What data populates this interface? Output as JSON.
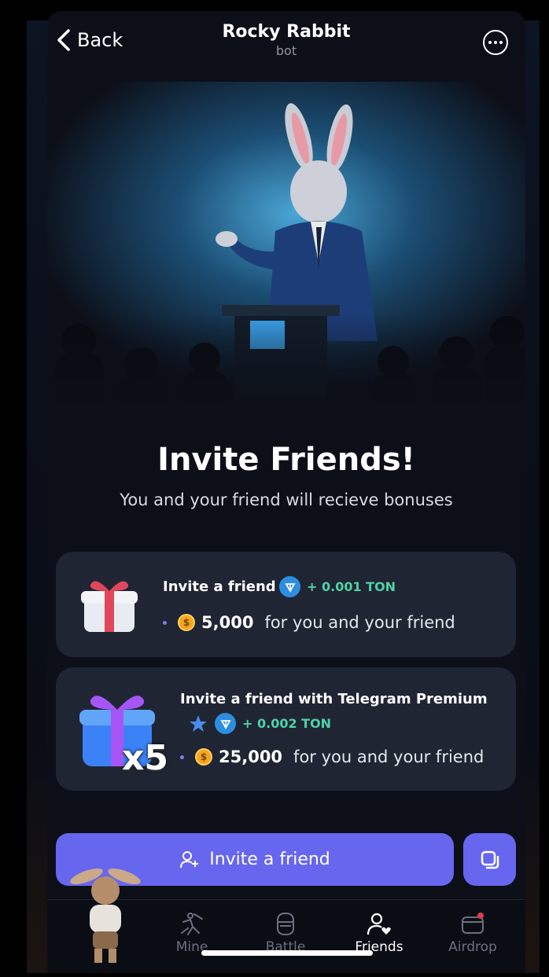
{
  "header": {
    "back_label": "Back",
    "title": "Rocky Rabbit",
    "subtitle": "bot"
  },
  "main": {
    "headline": "Invite Friends!",
    "tagline": "You and your friend will recieve bonuses"
  },
  "cards": [
    {
      "title": "Invite a friend",
      "ton_bonus": "+ 0.001 TON",
      "amount": "5,000",
      "for_text": "for you and your friend"
    },
    {
      "title": "Invite a friend with Telegram Premium",
      "ton_bonus": "+ 0.002 TON",
      "amount": "25,000",
      "for_text": "for you and your friend",
      "multiplier": "x5"
    }
  ],
  "actions": {
    "invite_label": "Invite a friend"
  },
  "nav": {
    "items": [
      {
        "label": "Mine",
        "icon": "mine-icon",
        "active": false
      },
      {
        "label": "Battle",
        "icon": "battle-icon",
        "active": false
      },
      {
        "label": "Friends",
        "icon": "friends-icon",
        "active": true
      },
      {
        "label": "Airdrop",
        "icon": "airdrop-icon",
        "active": false
      }
    ]
  },
  "colors": {
    "accent": "#6766ee",
    "ton_green": "#4fd1a6",
    "card_bg": "#1f2533",
    "background": "#0c0f18"
  }
}
